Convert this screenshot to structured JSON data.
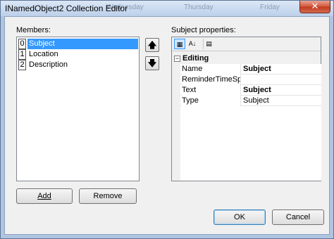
{
  "window": {
    "title": "INamedObject2 Collection Editor",
    "close_glyph": "✕",
    "background_ghost": [
      "Wednesday",
      "Thursday",
      "Friday"
    ]
  },
  "members": {
    "label": "Members:",
    "items": [
      {
        "index": "0",
        "name": "Subject",
        "selected": true
      },
      {
        "index": "1",
        "name": "Location",
        "selected": false
      },
      {
        "index": "2",
        "name": "Description",
        "selected": false
      }
    ],
    "move_up_icon": "arrow-up-icon",
    "move_down_icon": "arrow-down-icon",
    "move_up_glyph": "🡅",
    "move_down_glyph": "🡇"
  },
  "buttons": {
    "add": "Add",
    "remove": "Remove",
    "ok": "OK",
    "cancel": "Cancel"
  },
  "properties": {
    "label": "Subject properties:",
    "toolbar": [
      {
        "icon": "categorized-icon",
        "glyph": "▦",
        "active": true
      },
      {
        "icon": "alphabetical-icon",
        "glyph": "A↓",
        "active": false
      },
      {
        "icon": "property-pages-icon",
        "glyph": "▤",
        "active": false
      }
    ],
    "category": {
      "expander": "−",
      "name": "Editing"
    },
    "rows": [
      {
        "name": "Name",
        "value": "Subject",
        "bold": true
      },
      {
        "name": "ReminderTimeSpan",
        "value": "",
        "bold": false
      },
      {
        "name": "Text",
        "value": "Subject",
        "bold": true
      },
      {
        "name": "Type",
        "value": "Subject",
        "bold": false
      }
    ]
  },
  "colors": {
    "selection": "#3399ff",
    "frame": "#aec4e0"
  }
}
